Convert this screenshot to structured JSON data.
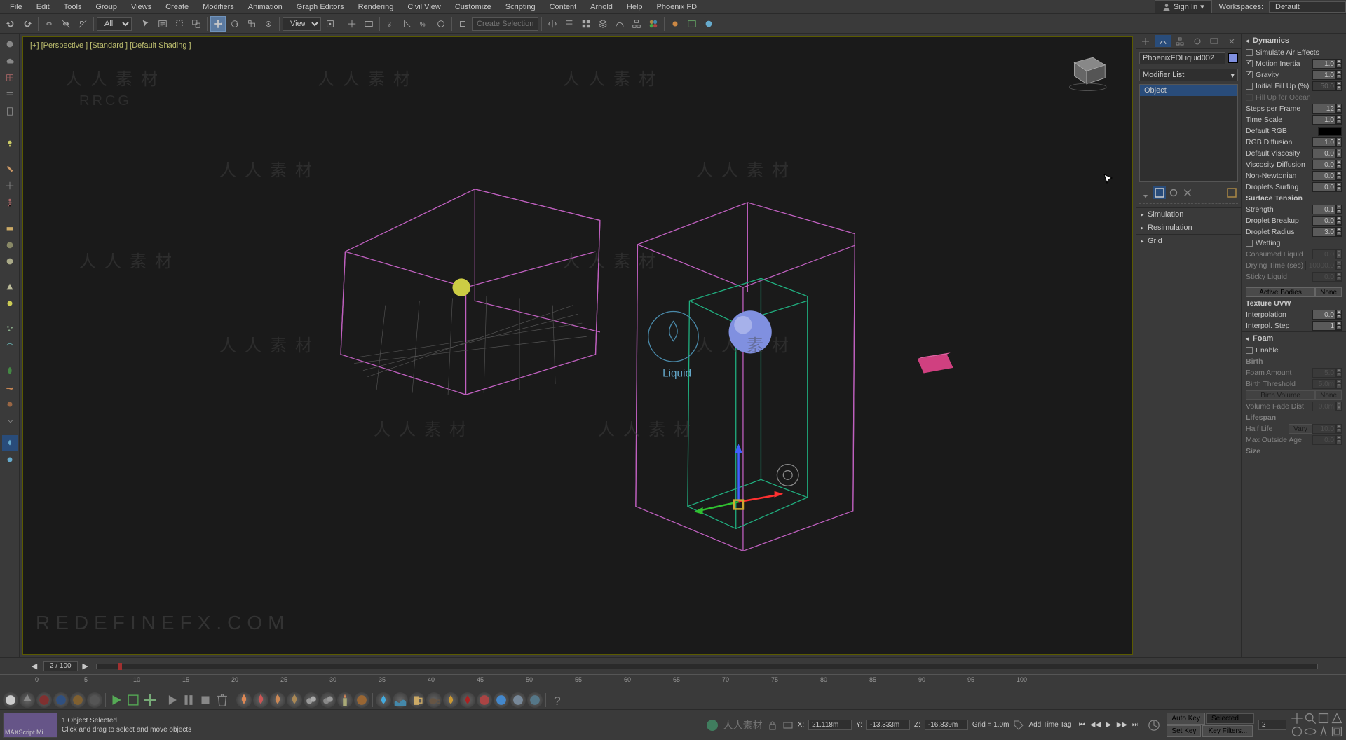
{
  "menu": {
    "items": [
      "File",
      "Edit",
      "Tools",
      "Group",
      "Views",
      "Create",
      "Modifiers",
      "Animation",
      "Graph Editors",
      "Rendering",
      "Civil View",
      "Customize",
      "Scripting",
      "Content",
      "Arnold",
      "Help",
      "Phoenix FD"
    ],
    "signin": "Sign In",
    "workspaces_label": "Workspaces:",
    "workspace": "Default"
  },
  "toolbar": {
    "selection_set_placeholder": "Create Selection Se",
    "view_label": "View",
    "all_label": "All"
  },
  "viewport": {
    "label": "[+] [Perspective ] [Standard ] [Default Shading ]",
    "helper_label": "Liquid",
    "brand": "REDEFINEFX.COM",
    "wm_cn": "人人素材",
    "wm_en": "RRCG"
  },
  "mod_panel": {
    "object_name": "PhoenixFDLiquid002",
    "modifier_list": "Modifier List",
    "stack_item": "Object",
    "rollouts": [
      "Simulation",
      "Resimulation",
      "Grid"
    ]
  },
  "dynamics": {
    "title": "Dynamics",
    "simulate_air_effects": {
      "label": "Simulate Air Effects",
      "checked": false
    },
    "motion_inertia": {
      "label": "Motion Inertia",
      "checked": true,
      "val": "1.0"
    },
    "gravity": {
      "label": "Gravity",
      "checked": true,
      "val": "1.0"
    },
    "initial_fill": {
      "label": "Initial Fill Up (%)",
      "checked": false,
      "val": "50.0"
    },
    "fill_ocean": {
      "label": "Fill Up for Ocean",
      "checked": false
    },
    "steps_per_frame": {
      "label": "Steps per Frame",
      "val": "12"
    },
    "time_scale": {
      "label": "Time Scale",
      "val": "1.0"
    },
    "default_rgb": {
      "label": "Default RGB"
    },
    "rgb_diffusion": {
      "label": "RGB Diffusion",
      "val": "1.0"
    },
    "default_viscosity": {
      "label": "Default Viscosity",
      "val": "0.0"
    },
    "viscosity_diffusion": {
      "label": "Viscosity Diffusion",
      "val": "0.0"
    },
    "non_newtonian": {
      "label": "Non-Newtonian",
      "val": "0.0"
    },
    "droplets_surfing": {
      "label": "Droplets Surfing",
      "val": "0.0"
    },
    "surface_tension": {
      "label": "Surface Tension"
    },
    "strength": {
      "label": "Strength",
      "val": "0.1"
    },
    "droplet_breakup": {
      "label": "Droplet Breakup",
      "val": "0.0"
    },
    "droplet_radius": {
      "label": "Droplet Radius",
      "val": "3.0"
    },
    "wetting": {
      "label": "Wetting",
      "checked": false
    },
    "consumed_liquid": {
      "label": "Consumed Liquid",
      "val": "0.0"
    },
    "drying_time": {
      "label": "Drying Time (sec)",
      "val": "10000.0"
    },
    "sticky_liquid": {
      "label": "Sticky Liquid",
      "val": "0.0"
    },
    "active_bodies": {
      "label": "Active Bodies",
      "btn": "None"
    },
    "texture_uvw": {
      "label": "Texture UVW"
    },
    "interpolation": {
      "label": "Interpolation",
      "val": "0.0"
    },
    "interpol_step": {
      "label": "Interpol. Step",
      "val": "1"
    }
  },
  "foam": {
    "title": "Foam",
    "enable": {
      "label": "Enable",
      "checked": false
    },
    "birth": {
      "label": "Birth"
    },
    "foam_amount": {
      "label": "Foam Amount",
      "val": "5.0"
    },
    "birth_threshold": {
      "label": "Birth Threshold",
      "val": "5.0m"
    },
    "birth_volume": {
      "label": "Birth Volume",
      "btn": "None"
    },
    "volume_fade_dist": {
      "label": "Volume Fade Dist",
      "val": "0.0m"
    },
    "lifespan": {
      "label": "Lifespan"
    },
    "half_life": {
      "label": "Half Life",
      "vary": "Vary",
      "val": "10.0"
    },
    "max_outside_age": {
      "label": "Max Outside Age",
      "val": "0.0"
    },
    "size": {
      "label": "Size"
    }
  },
  "timeline": {
    "frame_display": "2 / 100",
    "ticks": [
      0,
      5,
      10,
      15,
      20,
      25,
      30,
      35,
      40,
      45,
      50,
      55,
      60,
      65,
      70,
      75,
      80,
      85,
      90,
      95,
      100
    ]
  },
  "status": {
    "maxscript": "MAXScript Mi",
    "selected": "1 Object Selected",
    "hint": "Click and drag to select and move objects",
    "add_tag": "Add Time Tag",
    "x_label": "X:",
    "x": "21.118m",
    "y_label": "Y:",
    "y": "-13.333m",
    "z_label": "Z:",
    "z": "-16.839m",
    "grid": "Grid = 1.0m",
    "auto_key": "Auto Key",
    "selected_dd": "Selected",
    "set_key": "Set Key",
    "key_filters": "Key Filters...",
    "frame_field": "2"
  }
}
